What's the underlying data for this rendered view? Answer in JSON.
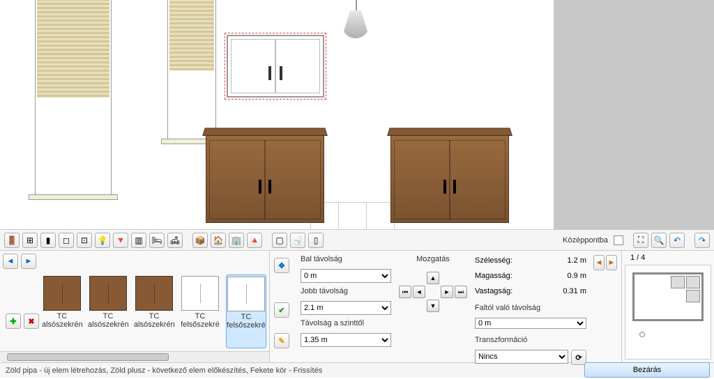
{
  "toolbar": {
    "center_label": "Középpontba"
  },
  "gallery": {
    "items": [
      {
        "code": "TC",
        "name": "alsószekrén",
        "variant": "wood"
      },
      {
        "code": "TC",
        "name": "alsószekrén",
        "variant": "wood"
      },
      {
        "code": "TC",
        "name": "alsószekrén",
        "variant": "wood"
      },
      {
        "code": "TC",
        "name": "felsőszekré",
        "variant": "white"
      },
      {
        "code": "TC",
        "name": "felsőszekré",
        "variant": "white"
      }
    ]
  },
  "fields": {
    "left_dist_label": "Bal távolság",
    "left_dist_value": "0 m",
    "right_dist_label": "Jobb távolság",
    "right_dist_value": "2.1 m",
    "level_dist_label": "Távolság a szinttől",
    "level_dist_value": "1.35 m",
    "move_label": "Mozgatás",
    "width_label": "Szélesség:",
    "width_value": "1.2 m",
    "height_label": "Magasság:",
    "height_value": "0.9 m",
    "thickness_label": "Vastagság:",
    "thickness_value": "0.31 m",
    "wall_dist_label": "Faltól való távolság",
    "wall_dist_value": "0 m",
    "transform_label": "Transzformáció",
    "transform_value": "Nincs"
  },
  "pager": {
    "text": "1 / 4"
  },
  "status": {
    "text": "Zöld pipa - új elem létrehozás, Zöld plusz - következő elem előkészítés, Fekete kör - Frissítés"
  },
  "close": {
    "label": "Bezárás"
  }
}
